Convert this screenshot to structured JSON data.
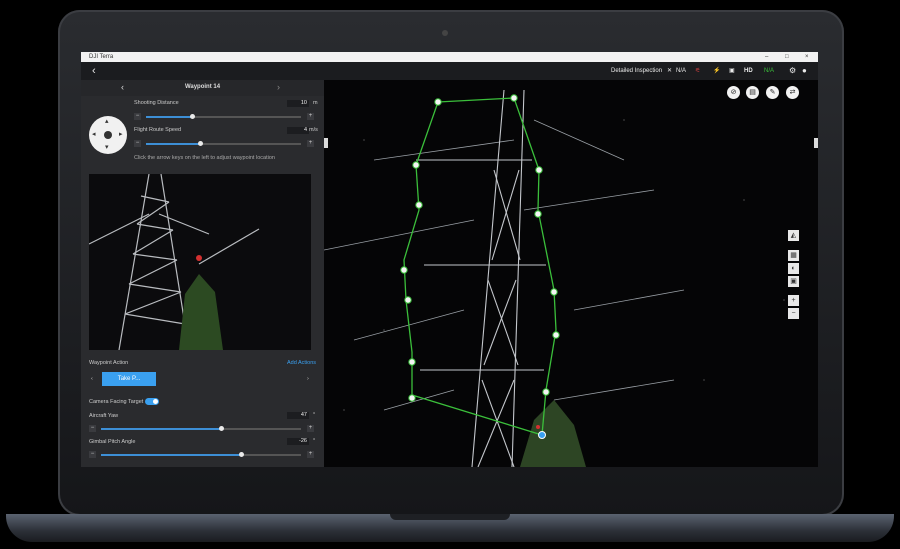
{
  "window": {
    "title": "DJI Terra",
    "controls": [
      "–",
      "□",
      "×"
    ]
  },
  "topbar": {
    "back_icon": "chevron-left-icon",
    "mode": "Detailed Inspection",
    "rtk_value": "N/A",
    "rc_label": "HD",
    "signal_value": "N/A"
  },
  "panel": {
    "title": "Waypoint 14",
    "shooting_distance": {
      "label": "Shooting Distance",
      "value": "10",
      "unit": "m",
      "level": 0.3
    },
    "flight_speed": {
      "label": "Flight Route Speed",
      "value": "4",
      "unit": "m/s",
      "level": 0.35
    },
    "hint": "Click the arrow keys on the left to adjust waypoint location",
    "waypoint_action": {
      "label": "Waypoint Action",
      "add_label": "Add Actions",
      "chip": "Take P..."
    },
    "camera_facing": {
      "label": "Camera Facing Target",
      "on": true
    },
    "aircraft_yaw": {
      "label": "Aircraft Yaw",
      "value": "47",
      "unit": "°",
      "level": 0.6
    },
    "gimbal_pitch": {
      "label": "Gimbal Pitch Angle",
      "value": "-26",
      "unit": "°",
      "level": 0.7
    }
  },
  "map_toolbar": [
    "no-fly-icon",
    "delete-icon",
    "edit-icon",
    "route-icon"
  ],
  "side_tools": [
    "layers-icon",
    "grid-icon",
    "sphere-icon",
    "camera-view-icon",
    "zoom-in-icon",
    "zoom-out-icon"
  ],
  "accent_color": "#3aa0f0",
  "route_color": "#3bbf3b"
}
